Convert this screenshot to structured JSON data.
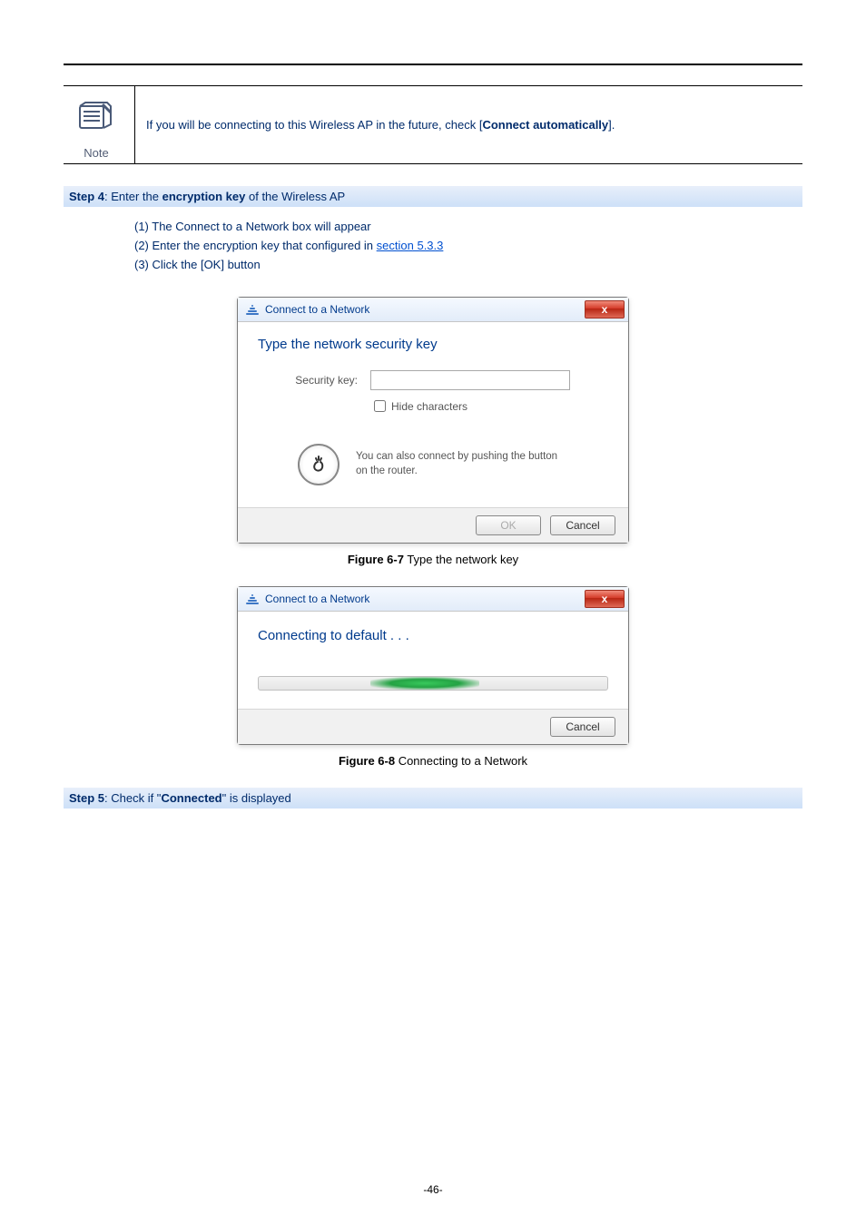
{
  "note": {
    "label": "Note",
    "text_prefix": "If you will be connecting to this Wireless AP in the future, check [",
    "text_bold": "Connect automatically",
    "text_suffix": "]."
  },
  "step4": {
    "label": "Step 4",
    "separator": ": Enter the ",
    "bold": "encryption key",
    "suffix": " of the Wireless AP",
    "items": {
      "i1": "(1)  The Connect to a Network box will appear",
      "i2_prefix": "(2)  Enter the encryption key that configured in ",
      "i2_link": "section 5.3.3",
      "i3": "(3)  Click the [OK] button"
    }
  },
  "dialog1": {
    "title": "Connect to a Network",
    "close": "x",
    "heading": "Type the network security key",
    "label": "Security key:",
    "value": "",
    "hide": "Hide characters",
    "wps": "You can also connect by pushing the button on the router.",
    "ok": "OK",
    "cancel": "Cancel"
  },
  "caption1_bold": "Figure 6-7",
  "caption1_rest": " Type the network key",
  "dialog2": {
    "title": "Connect to a Network",
    "close": "x",
    "connecting": "Connecting to default . . .",
    "cancel": "Cancel"
  },
  "caption2_bold": "Figure 6-8",
  "caption2_rest": " Connecting to a Network",
  "step5": {
    "label": "Step 5",
    "separator": ": Check if \"",
    "bold": "Connected",
    "suffix": "\" is displayed"
  },
  "page_number": "-46-"
}
